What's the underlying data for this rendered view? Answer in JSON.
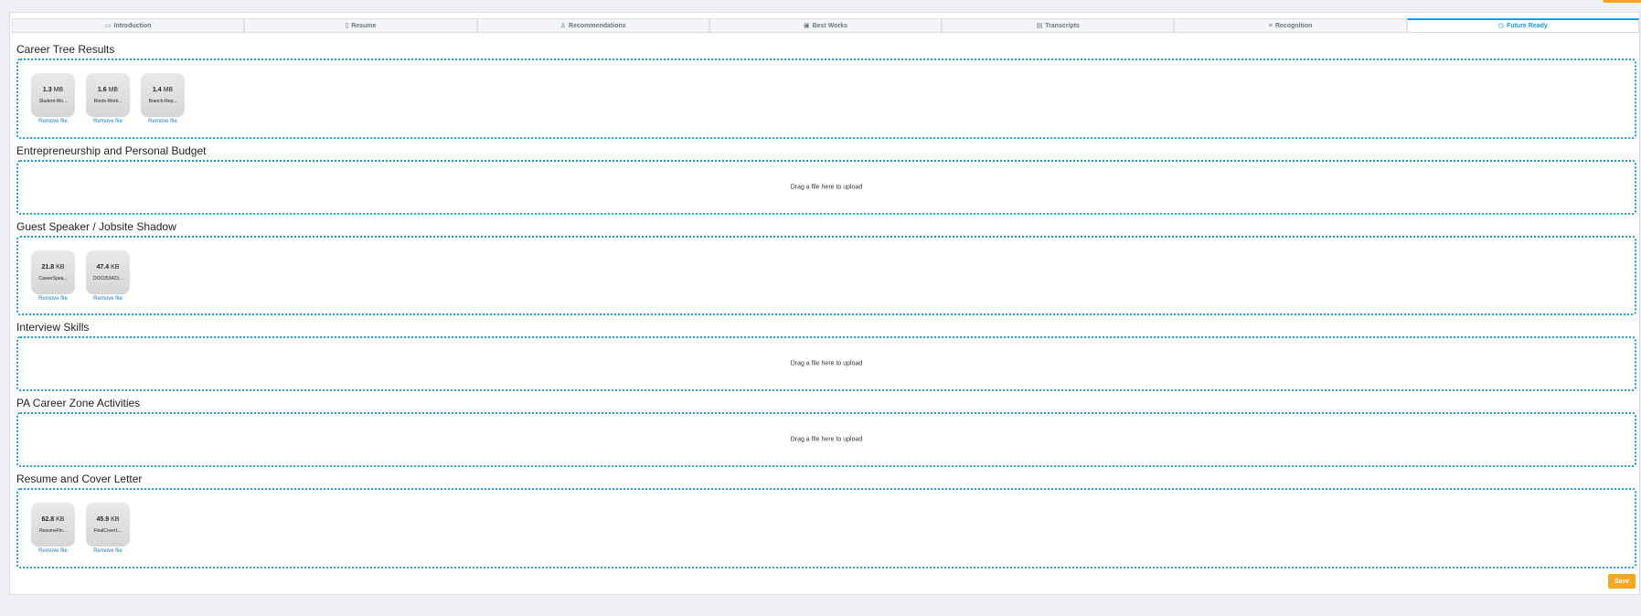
{
  "tabs": [
    {
      "label": "Introduction",
      "icon": "monitor-icon",
      "glyph": "▭"
    },
    {
      "label": "Resume",
      "icon": "document-icon",
      "glyph": "▯"
    },
    {
      "label": "Recommendations",
      "icon": "thumbs-up-icon",
      "glyph": "♙"
    },
    {
      "label": "Best Works",
      "icon": "folder-icon",
      "glyph": "▣"
    },
    {
      "label": "Transcripts",
      "icon": "file-text-icon",
      "glyph": "▤"
    },
    {
      "label": "Recognition",
      "icon": "list-icon",
      "glyph": "≡"
    },
    {
      "label": "Future Ready",
      "icon": "clock-icon",
      "glyph": "◷"
    }
  ],
  "active_tab": "Future Ready",
  "sections": {
    "career_tree": {
      "title": "Career Tree Results",
      "files": [
        {
          "size": "1.3",
          "unit": "MB",
          "name": "Student-Wo...",
          "remove": "Remove file"
        },
        {
          "size": "1.6",
          "unit": "MB",
          "name": "Roots-Work...",
          "remove": "Remove file"
        },
        {
          "size": "1.4",
          "unit": "MB",
          "name": "Branch-Rep...",
          "remove": "Remove file"
        }
      ]
    },
    "entrepreneurship": {
      "title": "Entrepreneurship and Personal Budget",
      "message": "Drag a file here to upload"
    },
    "guest_speaker": {
      "title": "Guest Speaker / Jobsite Shadow",
      "files": [
        {
          "size": "21.8",
          "unit": "KB",
          "name": "CareerSpea...",
          "remove": "Remove file"
        },
        {
          "size": "47.4",
          "unit": "KB",
          "name": "DOC053423...",
          "remove": "Remove file"
        }
      ]
    },
    "interview": {
      "title": "Interview Skills",
      "message": "Drag a file here to upload"
    },
    "pa_career": {
      "title": "PA Career Zone Activities",
      "message": "Drag a file here to upload"
    },
    "resume_cover": {
      "title": "Resume and Cover Letter",
      "files": [
        {
          "size": "62.8",
          "unit": "KB",
          "name": "ResumeFin...",
          "remove": "Remove file"
        },
        {
          "size": "45.9",
          "unit": "KB",
          "name": "FinalCoverL...",
          "remove": "Remove file"
        }
      ]
    }
  },
  "save_label": "Save",
  "colors": {
    "accent": "#1e9be0",
    "save": "#f5a623"
  }
}
